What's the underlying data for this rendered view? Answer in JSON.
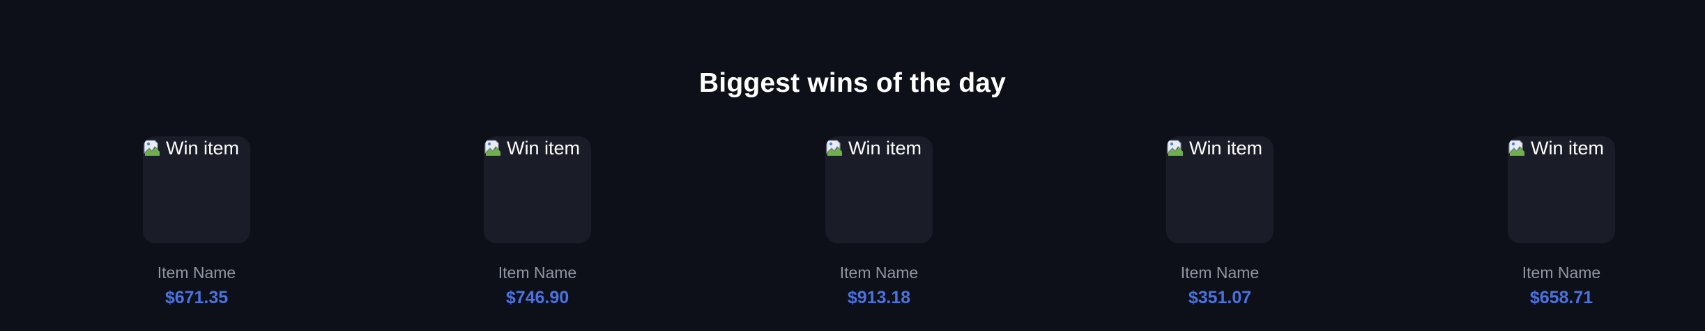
{
  "section": {
    "title": "Biggest wins of the day"
  },
  "colors": {
    "background": "#0d1018",
    "card": "#1a1c28",
    "title": "#ffffff",
    "item_name": "#9095a3",
    "price": "#4a72e0"
  },
  "items": [
    {
      "image_alt": "Win item",
      "name": "Item Name",
      "price": "$671.35",
      "icon": "broken-image-icon"
    },
    {
      "image_alt": "Win item",
      "name": "Item Name",
      "price": "$746.90",
      "icon": "broken-image-icon"
    },
    {
      "image_alt": "Win item",
      "name": "Item Name",
      "price": "$913.18",
      "icon": "broken-image-icon"
    },
    {
      "image_alt": "Win item",
      "name": "Item Name",
      "price": "$351.07",
      "icon": "broken-image-icon"
    },
    {
      "image_alt": "Win item",
      "name": "Item Name",
      "price": "$658.71",
      "icon": "broken-image-icon"
    }
  ]
}
